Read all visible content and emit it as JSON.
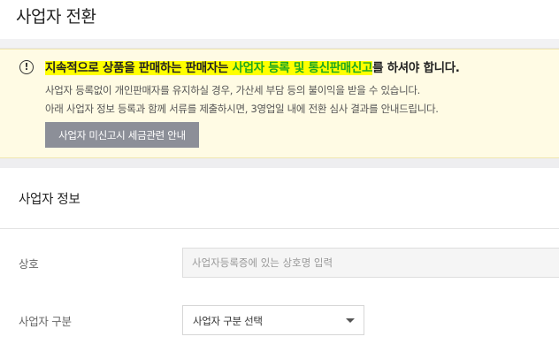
{
  "page": {
    "title": "사업자 전환"
  },
  "notice": {
    "icon": "exclamation-circle-icon",
    "headline_part1": "지속적으로 상품을 판매하는 판매자는",
    "headline_part2": " 사업자 등록 및 통신판매신고",
    "headline_part3": "를 하셔야 합니다.",
    "line1": "사업자 등록없이 개인판매자를 유지하실 경우, 가산세 부담 등의 불이익을 받을 수 있습니다.",
    "line2": "아래 사업자 정보 등록과 함께 서류를 제출하시면, 3영업일 내에 전환 심사 결과를 안내드립니다.",
    "button_label": "사업자 미신고시 세금관련 안내",
    "highlight_color": "#ffff00",
    "highlight_text_color": "#1fa81f"
  },
  "section": {
    "title": "사업자 정보"
  },
  "form": {
    "company_label": "상호",
    "company_placeholder": "사업자등록증에 있는 상호명 입력",
    "company_value": "",
    "type_label": "사업자 구분",
    "type_selected": "사업자 구분 선택",
    "type_icon": "triangle-down-icon"
  }
}
